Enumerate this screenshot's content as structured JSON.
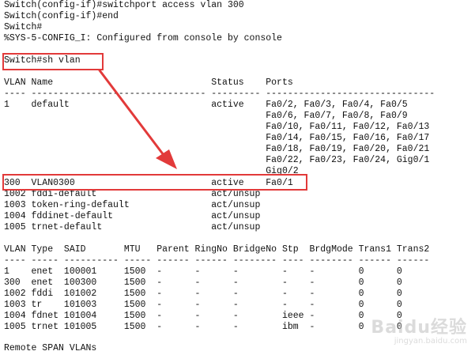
{
  "terminal": {
    "lines": [
      "Switch(config-if)#switchport access vlan 300",
      "Switch(config-if)#end",
      "Switch#",
      "%SYS-5-CONFIG_I: Configured from console by console",
      "",
      "Switch#sh vlan",
      "",
      "VLAN Name                             Status    Ports",
      "---- -------------------------------- --------- -------------------------------",
      "1    default                          active    Fa0/2, Fa0/3, Fa0/4, Fa0/5",
      "                                                Fa0/6, Fa0/7, Fa0/8, Fa0/9",
      "                                                Fa0/10, Fa0/11, Fa0/12, Fa0/13",
      "                                                Fa0/14, Fa0/15, Fa0/16, Fa0/17",
      "                                                Fa0/18, Fa0/19, Fa0/20, Fa0/21",
      "                                                Fa0/22, Fa0/23, Fa0/24, Gig0/1",
      "                                                Gig0/2",
      "300  VLAN0300                         active    Fa0/1",
      "1002 fddi-default                     act/unsup",
      "1003 token-ring-default               act/unsup",
      "1004 fddinet-default                  act/unsup",
      "1005 trnet-default                    act/unsup",
      "",
      "VLAN Type  SAID       MTU   Parent RingNo BridgeNo Stp  BrdgMode Trans1 Trans2",
      "---- ----- ---------- ----- ------ ------ -------- ---- -------- ------ ------",
      "1    enet  100001     1500  -      -      -        -    -        0      0",
      "300  enet  100300     1500  -      -      -        -    -        0      0",
      "1002 fddi  101002     1500  -      -      -        -    -        0      0",
      "1003 tr    101003     1500  -      -      -        -    -        0      0",
      "1004 fdnet 101004     1500  -      -      -        ieee -        0      0",
      "1005 trnet 101005     1500  -      -      -        ibm  -        0      0",
      "",
      "Remote SPAN VLANs"
    ]
  },
  "watermark": {
    "main": "Baidu经验",
    "sub": "jingyan.baidu.com"
  },
  "colors": {
    "annotation": "#e23a3a",
    "text": "#111111",
    "background": "#ffffff"
  }
}
